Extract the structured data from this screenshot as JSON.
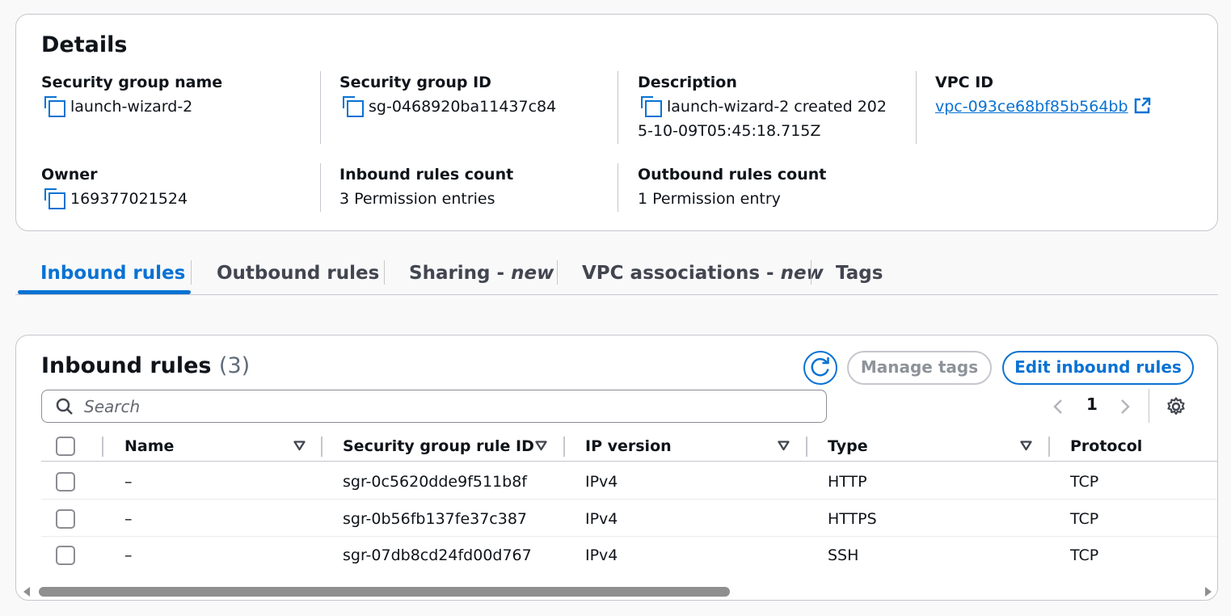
{
  "details": {
    "title": "Details",
    "security_group_name": {
      "label": "Security group name",
      "value": "launch-wizard-2"
    },
    "security_group_id": {
      "label": "Security group ID",
      "value": "sg-0468920ba11437c84"
    },
    "description": {
      "label": "Description",
      "value_line1": "launch-wizard-2 created 202",
      "value_line2": "5-10-09T05:45:18.715Z"
    },
    "vpc_id": {
      "label": "VPC ID",
      "value": "vpc-093ce68bf85b564bb"
    },
    "owner": {
      "label": "Owner",
      "value": "169377021524"
    },
    "inbound_rules_count": {
      "label": "Inbound rules count",
      "value": "3 Permission entries"
    },
    "outbound_rules_count": {
      "label": "Outbound rules count",
      "value": "1 Permission entry"
    }
  },
  "tabs": [
    {
      "label": "Inbound rules",
      "active": true
    },
    {
      "label": "Outbound rules"
    },
    {
      "label": "Sharing - ",
      "suffix": "new"
    },
    {
      "label": "VPC associations - ",
      "suffix": "new"
    },
    {
      "label": "Tags"
    }
  ],
  "inbound": {
    "title": "Inbound rules",
    "count": "(3)",
    "manage_tags_label": "Manage tags",
    "edit_rules_label": "Edit inbound rules",
    "search_placeholder": "Search",
    "page": "1",
    "columns": [
      "Name",
      "Security group rule ID",
      "IP version",
      "Type",
      "Protocol"
    ],
    "rows": [
      {
        "name": "–",
        "rule_id": "sgr-0c5620dde9f511b8f",
        "ip_version": "IPv4",
        "type": "HTTP",
        "protocol": "TCP"
      },
      {
        "name": "–",
        "rule_id": "sgr-0b56fb137fe37c387",
        "ip_version": "IPv4",
        "type": "HTTPS",
        "protocol": "TCP"
      },
      {
        "name": "–",
        "rule_id": "sgr-07db8cd24fd00d767",
        "ip_version": "IPv4",
        "type": "SSH",
        "protocol": "TCP"
      }
    ]
  },
  "colors": {
    "accent": "#0972d3",
    "border": "#c6c6cd",
    "text": "#0f141a"
  }
}
